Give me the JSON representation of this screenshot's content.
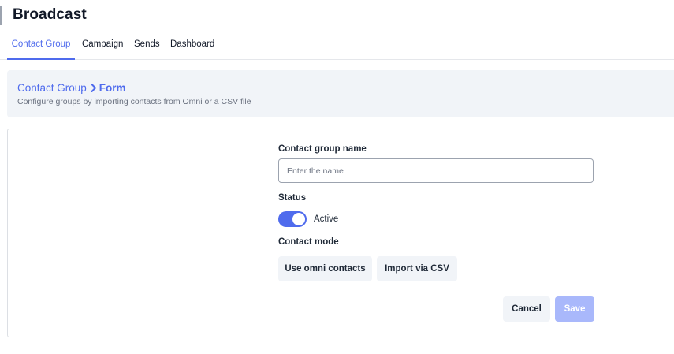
{
  "app": {
    "title": "Broadcast"
  },
  "tabs": [
    {
      "label": "Contact Group",
      "active": true
    },
    {
      "label": "Campaign",
      "active": false
    },
    {
      "label": "Sends",
      "active": false
    },
    {
      "label": "Dashboard",
      "active": false
    }
  ],
  "header": {
    "breadcrumb_parent": "Contact Group",
    "breadcrumb_current": "Form",
    "subtitle": "Configure groups by importing contacts from Omni or a CSV file"
  },
  "form": {
    "name_label": "Contact group name",
    "name_placeholder": "Enter the name",
    "name_value": "",
    "status_label": "Status",
    "status_value": "Active",
    "status_on": true,
    "mode_label": "Contact mode",
    "mode_omni": "Use omni contacts",
    "mode_csv": "Import via CSV",
    "cancel_label": "Cancel",
    "save_label": "Save"
  },
  "icons": {
    "breadcrumb_separator": "chevron-right-icon"
  },
  "colors": {
    "accent": "#4f6bed",
    "save_disabled": "#a9b8fb",
    "panel_bg": "#f1f4f8",
    "border": "#dcdfe4"
  }
}
